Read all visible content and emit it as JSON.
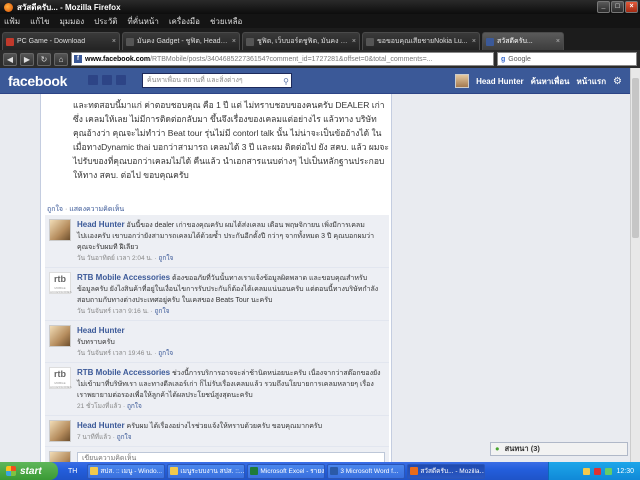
{
  "window": {
    "title": "สวัสดีครับ... - Mozilla Firefox",
    "min": "_",
    "max": "□",
    "close": "×"
  },
  "menu": [
    "แฟ้ม",
    "แก้ไข",
    "มุมมอง",
    "ประวัติ",
    "ที่คั่นหน้า",
    "เครื่องมือ",
    "ช่วยเหลือ"
  ],
  "tabs": [
    {
      "label": "PC Game - Download",
      "color": "#c0392b"
    },
    {
      "label": "มันคง Gadget - ชูฟิต, Headp...",
      "color": "#555"
    },
    {
      "label": "ชูฟิต, เว็บบอร์ดชูฟิต, มันคง G...",
      "color": "#555"
    },
    {
      "label": "ขอขอบคุณเสียชายNokia Lu...",
      "color": "#555"
    },
    {
      "label": "สวัสดีครับ...",
      "color": "#3b5998"
    }
  ],
  "nav": {
    "back": "◀",
    "forward": "▶",
    "reload": "↻",
    "home": "⌂",
    "url_domain": "www.facebook.com",
    "url_rest": "/RTBMobile/posts/340468522736154?comment_id=1727281&offset=0&total_comments=...",
    "search_engine": "g",
    "search_placeholder": "Google"
  },
  "facebook": {
    "logo": "facebook",
    "search_placeholder": "ค้นหาเพื่อน สถานที่ และสิ่งต่างๆ",
    "user_name": "Head Hunter",
    "find_friends": "ค้นหาเพื่อน",
    "home": "หน้าแรก",
    "gear": "⚙"
  },
  "post": {
    "body": "และทดสอบนี้มาแก่ ค่าตอบชอบคุณ คือ 1 ปี แต่ ไม่ทราบชอบของคนครับ DEALER เก่า ซึ่ง เคลมให้เลย ไม่มีการติดต่อกลับมา ขึ้นจึงเรื่องของเคลมแต่อย่างไร แล้วทาง บริษัทคุณอ้างว่า คุณจะไม่ทำว่า Beat tour รุ่นไม่มี contorl talk นั้น ไม่น่าจะเป็นข้ออ้างได้ ในเมื่อทางDynamic thai บอกว่าสามารถ เคลมได้ 3 ปี และผม ติดต่อไป ยัง สคบ. แล้ว ผมจะไปรับของที่คุณบอกว่าเคลมไม่ได้ คืนแล้ว นำเอกสารแนบต่างๆ ไปเป็นหลักฐานประกอบให้ทาง สคบ. ต่อไป ขอบคุณครับ",
    "like": "ถูกใจ",
    "dot": "·",
    "show_comments": "แสดงความคิดเห็น"
  },
  "comments": [
    {
      "author": "Head Hunter",
      "type": "hh",
      "text": "อันนี้ของ dealer เก่าของคุณครับ ผมได้ส่งเคลม เดือน พฤษจิกายน เพิ่งมีการเคลมไปเเองครับ เขาบอกว่ายังสามารถเคลมได้ด้วยซ้ำ ประกันอีกตั้งปี กว่าๆ จากทั้งหมด 3 ปี คุณบอกผมว่า คุณจะรับผมที ฝีเลียว",
      "time": "วัน วันอาทิตย์ เวลา 2:04 น.",
      "like": "ถูกใจ"
    },
    {
      "author": "RTB Mobile Accessories",
      "type": "rtb",
      "text": "ต้องขออภัยที่วันนั้นทางเราแจ้งข้อมูลผิดพลาด และขอบคุณสำหรับข้อมูลครับ ยังไงสินค้าที่อยู่ในเงื่อนไขการรับประกันก็ต้องได้เคลมแน่นอนครับ แต่ตอนนี้ทางบริษัทกำลังสอบถามกับทางต่างประเทศอยู่ครับ ในเคสของ Beats Tour นะครับ",
      "time": "วัน วันจันทร์ เวลา 9:16 น.",
      "like": "ถูกใจ"
    },
    {
      "author": "Head Hunter",
      "type": "hh",
      "text": "รับทราบครับ",
      "time": "วัน วันจันทร์ เวลา 19:46 น.",
      "like": "ถูกใจ"
    },
    {
      "author": "RTB Mobile Accessories",
      "type": "rtb",
      "text": "ช่วงนี้การบริการอาจจะล่าช้านิดหน่อยนะครับ เนื่องจากว่าสต๊อกของยังไม่เข้ามาที่บริษัทเรา และทางดีลเลอร์เก่า ก็ไม่รับเรื่องเคลมแล้ว รวมถึงนโยบายการเคลมหลายๆ เรื่อง เราพยายามต่อรองเพื่อให้ลูกค้าได้ผลประโยชน์สูงสุดนะครับ",
      "time": "21 ชั่วโมงที่แล้ว",
      "like": "ถูกใจ"
    },
    {
      "author": "Head Hunter",
      "type": "hh",
      "text": "ครับผม ได้เรื่องอย่างไรช่วยแจ้งให้ทราบด้วยครับ ขอบคุณมากครับ",
      "time": "7 นาทีที่แล้ว",
      "like": "ถูกใจ"
    }
  ],
  "comment_input_placeholder": "เขียนความคิดเห็น",
  "rtb_logo": "rtb",
  "rtb_logo_sub": "MOBILE ACCESSORIES",
  "chat": {
    "label": "สนทนา (3)",
    "icon": "●"
  },
  "taskbar": {
    "start": "start",
    "lang": "TH",
    "items": [
      {
        "label": "สปส. :: เมนู - Windo...",
        "color": "#f2c94c"
      },
      {
        "label": "เมนูระบบงาน สปส. ::...",
        "color": "#f2c94c"
      },
      {
        "label": "Microsoft Excel - รายง...",
        "color": "#1e7b3a"
      },
      {
        "label": "3 Microsoft Word f...",
        "color": "#2b5aa8"
      },
      {
        "label": "สวัสดีครับ... - Mozilla...",
        "color": "#e86b1b"
      }
    ],
    "clock": "12:30"
  }
}
